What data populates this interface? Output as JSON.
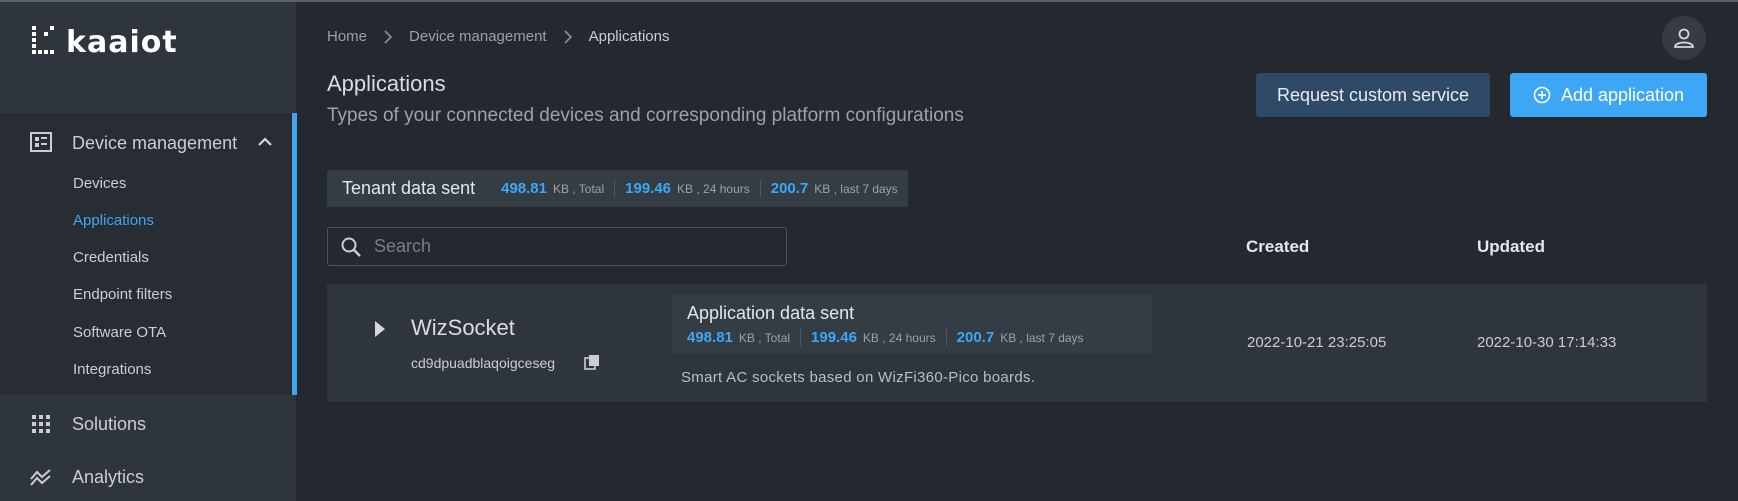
{
  "brand": {
    "logo_text": "kaaiot",
    "accent": "#3ea7f5"
  },
  "sidebar": {
    "group": {
      "label": "Device management",
      "icon": "device-management-icon",
      "expanded": true,
      "items": [
        {
          "label": "Devices",
          "active": false
        },
        {
          "label": "Applications",
          "active": true
        },
        {
          "label": "Credentials",
          "active": false
        },
        {
          "label": "Endpoint filters",
          "active": false
        },
        {
          "label": "Software OTA",
          "active": false
        },
        {
          "label": "Integrations",
          "active": false
        }
      ]
    },
    "items": [
      {
        "label": "Solutions",
        "icon": "grid-icon"
      },
      {
        "label": "Analytics",
        "icon": "analytics-icon"
      }
    ]
  },
  "breadcrumb": [
    "Home",
    "Device management",
    "Applications"
  ],
  "page": {
    "title": "Applications",
    "subtitle": "Types of your connected devices and corresponding platform configurations"
  },
  "buttons": {
    "request_custom": "Request custom service",
    "add_application": "Add application"
  },
  "tenant_stats": {
    "title": "Tenant data sent",
    "total": {
      "value": "498.81",
      "unit": "KB , Total"
    },
    "day": {
      "value": "199.46",
      "unit": "KB , 24 hours"
    },
    "week": {
      "value": "200.7",
      "unit": "KB , last 7 days"
    }
  },
  "search": {
    "placeholder": "Search",
    "value": ""
  },
  "columns": {
    "created": "Created",
    "updated": "Updated"
  },
  "applications": [
    {
      "name": "WizSocket",
      "id": "cd9dpuadblaqoigceseg",
      "stats_title": "Application data sent",
      "stats": {
        "total": {
          "value": "498.81",
          "unit": "KB , Total"
        },
        "day": {
          "value": "199.46",
          "unit": "KB , 24 hours"
        },
        "week": {
          "value": "200.7",
          "unit": "KB , last 7 days"
        }
      },
      "description": "Smart AC sockets based on WizFi360-Pico boards.",
      "created": "2022-10-21 23:25:05",
      "updated": "2022-10-30 17:14:33"
    }
  ]
}
